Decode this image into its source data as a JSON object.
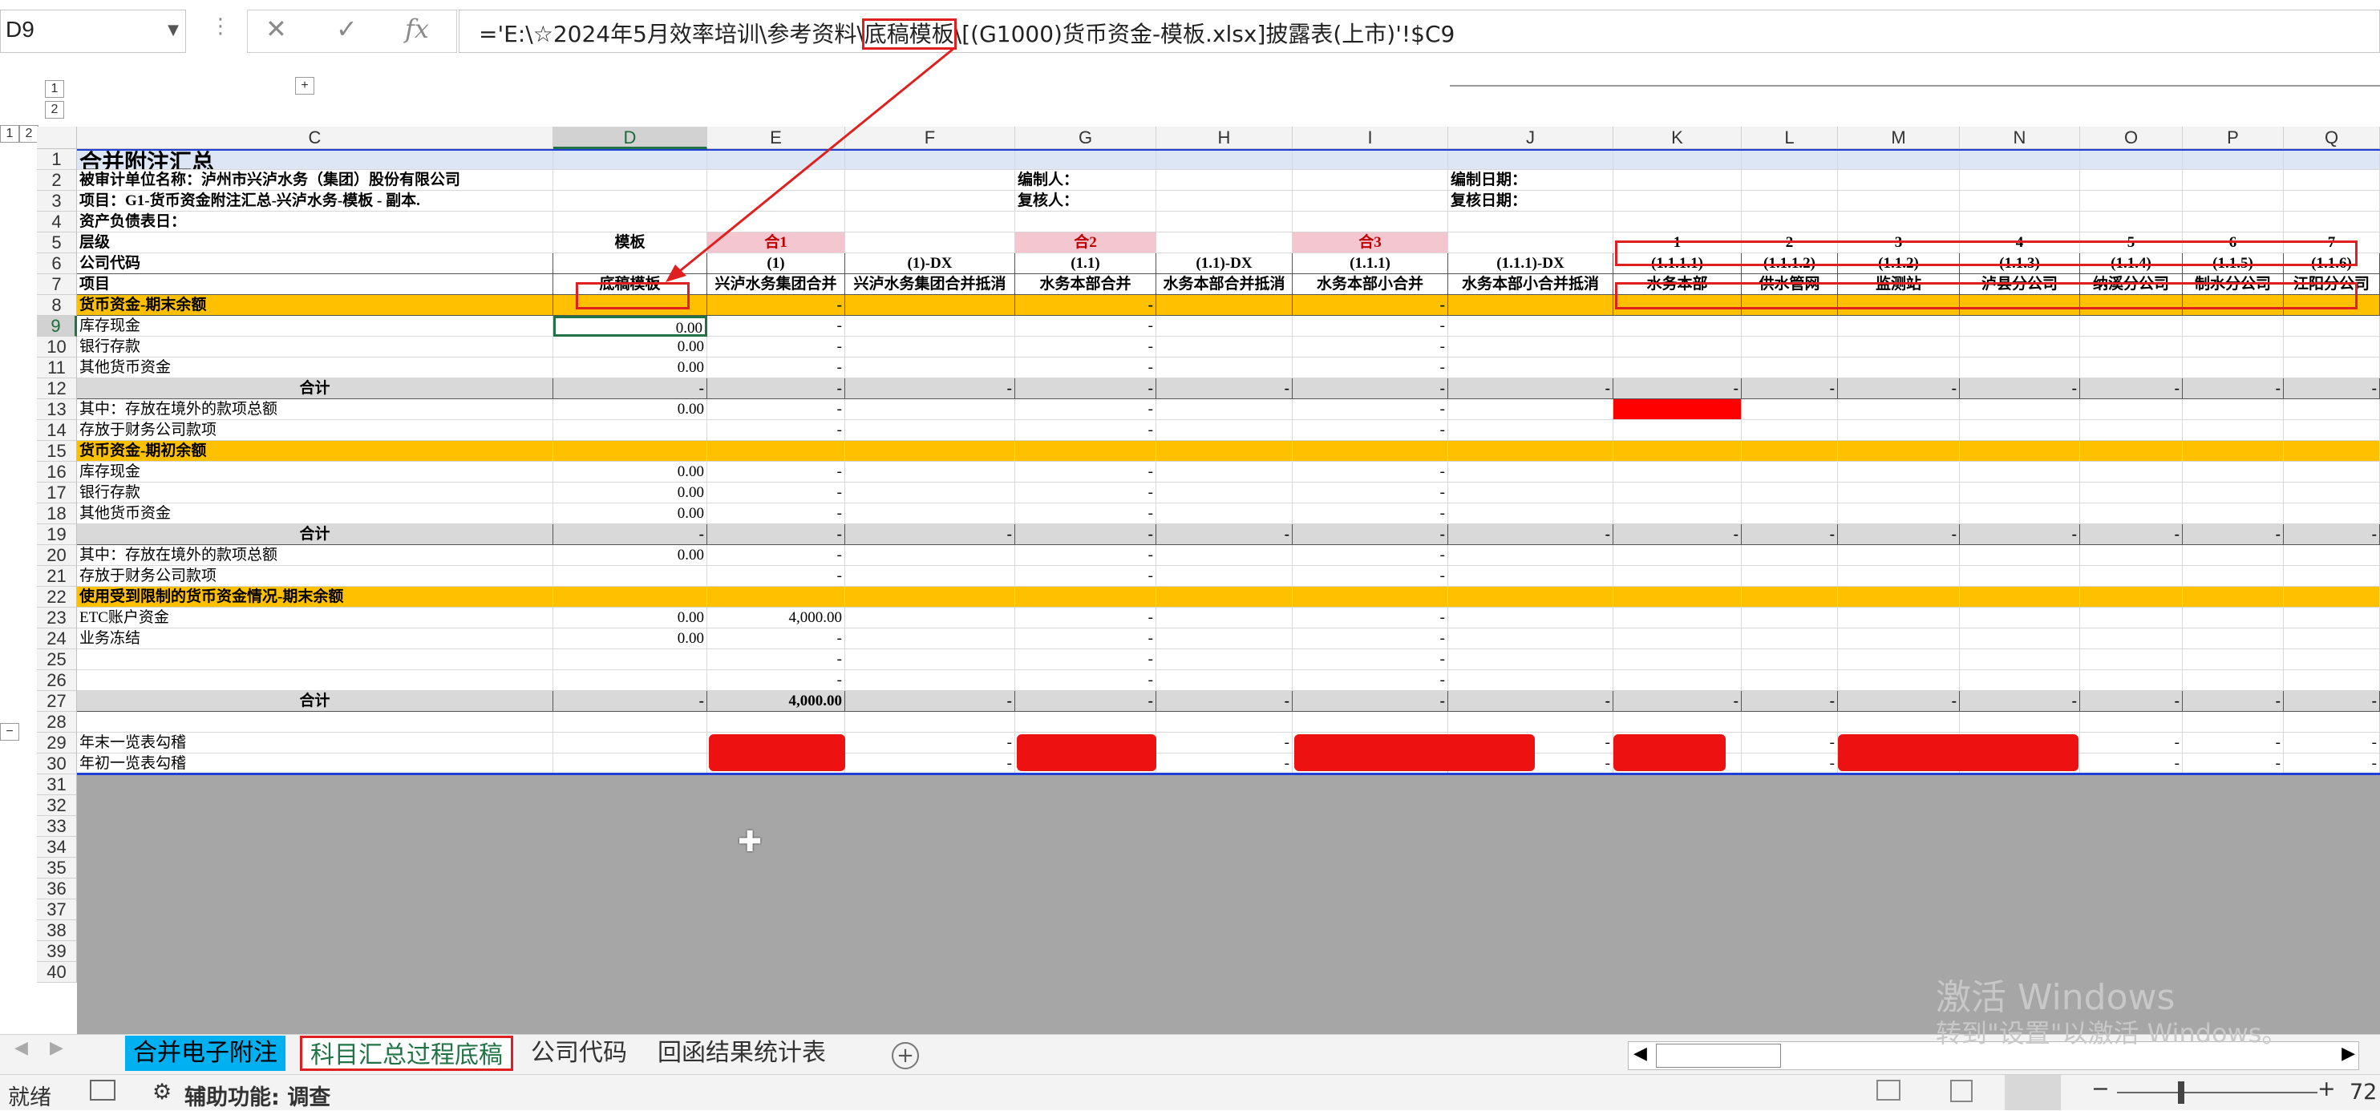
{
  "formula_bar": {
    "name_box": "D9",
    "cancel_icon": "✕",
    "enter_icon": "✓",
    "fx_label": "fx",
    "formula_prefix": "='E:\\☆2024年5月效率培训\\参考资料\\",
    "formula_highlight": "底稿模板",
    "formula_suffix": "\\[(G1000)货币资金-模板.xlsx]披露表(上市)'!$C9"
  },
  "outline": {
    "level1": "1",
    "level2": "2",
    "expand": "+",
    "collapse": "−"
  },
  "columns": [
    "C",
    "D",
    "E",
    "F",
    "G",
    "H",
    "I",
    "J",
    "K",
    "L",
    "M",
    "N",
    "O",
    "P",
    "Q"
  ],
  "rows": [
    {
      "n": "1",
      "C": "合并附注汇总",
      "style": "title"
    },
    {
      "n": "2",
      "C": "被审计单位名称：泸州市兴泸水务（集团）股份有限公司",
      "G": "编制人：",
      "J": "编制日期："
    },
    {
      "n": "3",
      "C": "项目：G1-货币资金附注汇总-兴泸水务-模板 - 副本.",
      "G": "复核人：",
      "J": "复核日期："
    },
    {
      "n": "4",
      "C": "资产负债表日："
    },
    {
      "n": "5",
      "C": "层级",
      "D": "模板",
      "E": "合1",
      "G": "合2",
      "I": "合3",
      "K": "1",
      "L": "2",
      "M": "3",
      "N": "4",
      "O": "5",
      "P": "6",
      "Q": "7"
    },
    {
      "n": "6",
      "C": "公司代码",
      "E": "(1)",
      "F": "(1)-DX",
      "G": "(1.1)",
      "H": "(1.1)-DX",
      "I": "(1.1.1)",
      "J": "(1.1.1)-DX",
      "K": "(1.1.1.1)",
      "L": "(1.1.1.2)",
      "M": "(1.1.2)",
      "N": "(1.1.3)",
      "O": "(1.1.4)",
      "P": "(1.1.5)",
      "Q": "(1.1.6)"
    },
    {
      "n": "7",
      "C": "项目",
      "D": "底稿模板",
      "E": "兴泸水务集团合并",
      "F": "兴泸水务集团合并抵消",
      "G": "水务本部合并",
      "H": "水务本部合并抵消",
      "I": "水务本部小合并",
      "J": "水务本部小合并抵消",
      "K": "水务本部",
      "L": "供水管网",
      "M": "监测站",
      "N": "泸县分公司",
      "O": "纳溪分公司",
      "P": "制水分公司",
      "Q": "江阳分公司",
      "style": "header"
    },
    {
      "n": "8",
      "C": "货币资金-期末余额",
      "E": "-",
      "G": "-",
      "I": "-",
      "style": "section"
    },
    {
      "n": "9",
      "C": "库存现金",
      "D": "0.00",
      "E": "-",
      "G": "-",
      "I": "-"
    },
    {
      "n": "10",
      "C": "银行存款",
      "D": "0.00",
      "E": "-",
      "G": "-",
      "I": "-"
    },
    {
      "n": "11",
      "C": "其他货币资金",
      "D": "0.00",
      "E": "-",
      "G": "-",
      "I": "-"
    },
    {
      "n": "12",
      "C": "合计",
      "D": "-",
      "E": "-",
      "F": "-",
      "G": "-",
      "H": "-",
      "I": "-",
      "J": "-",
      "K": "-",
      "L": "-",
      "M": "-",
      "N": "-",
      "O": "-",
      "P": "-",
      "Q": "-",
      "style": "total"
    },
    {
      "n": "13",
      "C": "其中：存放在境外的款项总额",
      "D": "0.00",
      "E": "-",
      "G": "-",
      "I": "-"
    },
    {
      "n": "14",
      "C": "      存放于财务公司款项",
      "E": "-",
      "G": "-",
      "I": "-"
    },
    {
      "n": "15",
      "C": "货币资金-期初余额",
      "style": "section"
    },
    {
      "n": "16",
      "C": "库存现金",
      "D": "0.00",
      "E": "-",
      "G": "-",
      "I": "-"
    },
    {
      "n": "17",
      "C": "银行存款",
      "D": "0.00",
      "E": "-",
      "G": "-",
      "I": "-"
    },
    {
      "n": "18",
      "C": "其他货币资金",
      "D": "0.00",
      "E": "-",
      "G": "-",
      "I": "-"
    },
    {
      "n": "19",
      "C": "合计",
      "D": "-",
      "E": "-",
      "F": "-",
      "G": "-",
      "H": "-",
      "I": "-",
      "J": "-",
      "K": "-",
      "L": "-",
      "M": "-",
      "N": "-",
      "O": "-",
      "P": "-",
      "Q": "-",
      "style": "total"
    },
    {
      "n": "20",
      "C": "其中：存放在境外的款项总额",
      "D": "0.00",
      "E": "-",
      "G": "-",
      "I": "-"
    },
    {
      "n": "21",
      "C": "      存放于财务公司款项",
      "E": "-",
      "G": "-",
      "I": "-"
    },
    {
      "n": "22",
      "C": "使用受到限制的货币资金情况-期末余额",
      "style": "section"
    },
    {
      "n": "23",
      "C": "ETC账户资金",
      "D": "0.00",
      "E": "4,000.00",
      "G": "-",
      "I": "-"
    },
    {
      "n": "24",
      "C": "业务冻结",
      "D": "0.00",
      "E": "-",
      "G": "-",
      "I": "-"
    },
    {
      "n": "25",
      "E": "-",
      "G": "-",
      "I": "-"
    },
    {
      "n": "26",
      "E": "-",
      "G": "-",
      "I": "-"
    },
    {
      "n": "27",
      "C": "合计",
      "D": "-",
      "E": "4,000.00",
      "F": "-",
      "G": "-",
      "H": "-",
      "I": "-",
      "J": "-",
      "K": "-",
      "L": "-",
      "M": "-",
      "N": "-",
      "O": "-",
      "P": "-",
      "Q": "-",
      "style": "total"
    },
    {
      "n": "28"
    },
    {
      "n": "29",
      "C": "年末一览表勾稽",
      "F": "-",
      "H": "-",
      "J": "-",
      "L": "-",
      "M": "-",
      "O": "-",
      "P": "-",
      "Q": "-"
    },
    {
      "n": "30",
      "C": "年初一览表勾稽",
      "F": "-",
      "H": "-",
      "J": "-",
      "L": "-",
      "M": "-",
      "O": "-",
      "P": "-",
      "Q": "-"
    },
    {
      "n": "31"
    },
    {
      "n": "32"
    },
    {
      "n": "33"
    },
    {
      "n": "34"
    },
    {
      "n": "35"
    },
    {
      "n": "36"
    },
    {
      "n": "37"
    },
    {
      "n": "38"
    },
    {
      "n": "39"
    },
    {
      "n": "40"
    }
  ],
  "sheet_tabs": [
    {
      "label": "合并电子附注",
      "state": "highlighted"
    },
    {
      "label": "科目汇总过程底稿",
      "state": "active"
    },
    {
      "label": "公司代码",
      "state": "normal"
    },
    {
      "label": "回函结果统计表",
      "state": "normal"
    }
  ],
  "add_sheet": "+",
  "status": {
    "ready": "就绪",
    "accessibility": "辅助功能: 调查",
    "zoom": "72"
  },
  "watermark": {
    "line1": "激活 Windows",
    "line2": "转到\"设置\"以激活 Windows。"
  },
  "colors": {
    "section": "#ffc000",
    "pink": "#f4c7d0",
    "total": "#d9d9d9",
    "title_bg": "#dce6f5",
    "red": "#e02020",
    "grey_area": "#a6a6a6"
  }
}
